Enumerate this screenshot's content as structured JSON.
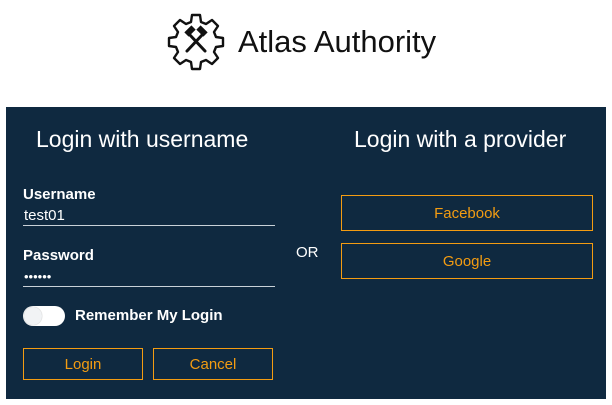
{
  "header": {
    "app_title": "Atlas Authority",
    "logo_icon": "gear-hammers-icon"
  },
  "username_login": {
    "title": "Login with username",
    "username_label": "Username",
    "username_value": "test01",
    "password_label": "Password",
    "password_value": "••••••",
    "remember_label": "Remember My Login",
    "remember_checked": false,
    "login_button": "Login",
    "cancel_button": "Cancel"
  },
  "divider": {
    "or_label": "OR"
  },
  "provider_login": {
    "title": "Login with a provider",
    "providers": [
      "Facebook",
      "Google"
    ]
  },
  "colors": {
    "panel_background": "#0f2940",
    "accent": "#f39c12",
    "text": "#ffffff"
  }
}
